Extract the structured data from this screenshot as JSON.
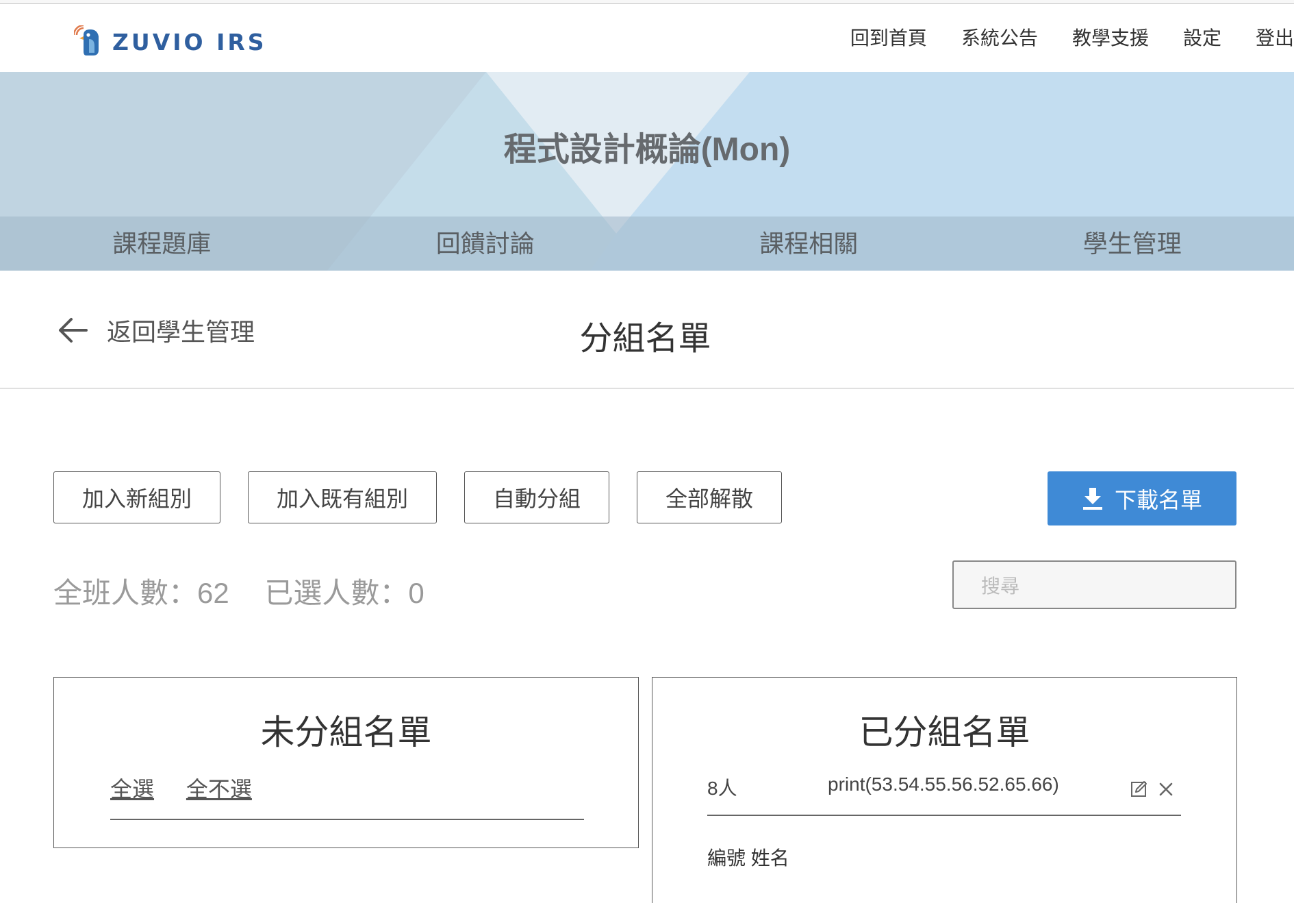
{
  "brand": {
    "name": "ZUVIO IRS"
  },
  "topnav": {
    "items": [
      "回到首頁",
      "系統公告",
      "教學支援",
      "設定",
      "登出"
    ]
  },
  "banner": {
    "course_title": "程式設計概論(Mon)"
  },
  "tabs": [
    "課程題庫",
    "回饋討論",
    "課程相關",
    "學生管理"
  ],
  "subheader": {
    "back_label": "返回學生管理",
    "title": "分組名單"
  },
  "actions": {
    "add_new_group": "加入新組別",
    "add_existing_group": "加入既有組別",
    "auto_group": "自動分組",
    "dissolve_all": "全部解散",
    "download": "下載名單"
  },
  "stats": {
    "total": "全班人數：62",
    "selected": "已選人數：0"
  },
  "search": {
    "placeholder": "搜尋"
  },
  "ungrouped": {
    "title": "未分組名單",
    "select_all": "全選",
    "select_none": "全不選"
  },
  "grouped": {
    "title": "已分組名單",
    "group": {
      "count": "8人",
      "name": "print(53.54.55.56.52.65.66)"
    },
    "columns": "編號  姓名"
  },
  "colors": {
    "accent": "#3f8ad6",
    "brand": "#2f5f9f",
    "banner": "#c3ddf0"
  },
  "icons": [
    "bird-logo-icon",
    "arrow-left-icon",
    "download-icon",
    "edit-icon",
    "close-icon"
  ]
}
